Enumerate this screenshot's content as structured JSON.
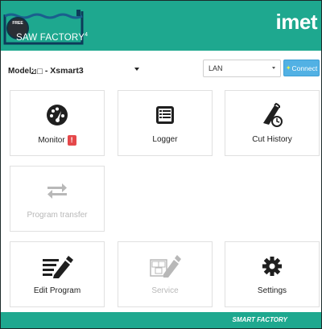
{
  "header": {
    "free_badge": "FREE",
    "logo_text": "SAW FACTORY",
    "logo_version": "4",
    "brand": "imet"
  },
  "toolbar": {
    "model_label": "Model:",
    "model_icon": "⊿□",
    "model_value": "- Xsmart3",
    "connection_value": "LAN",
    "connect_label": "Connect"
  },
  "tiles": {
    "monitor": {
      "label": "Monitor",
      "badge": "!",
      "icon": "speedometer-icon"
    },
    "logger": {
      "label": "Logger",
      "icon": "list-icon"
    },
    "cut_history": {
      "label": "Cut History",
      "icon": "saw-history-icon"
    },
    "program_transfer": {
      "label": "Program transfer",
      "icon": "transfer-icon"
    },
    "edit_program": {
      "label": "Edit Program",
      "icon": "edit-list-icon"
    },
    "service": {
      "label": "Service",
      "icon": "service-icon"
    },
    "settings": {
      "label": "Settings",
      "icon": "gear-icon"
    }
  },
  "footer": {
    "text": "SMART FACTORY"
  },
  "colors": {
    "header": "#1ea88f",
    "connect": "#52b1e4",
    "alert": "#e5484a"
  }
}
